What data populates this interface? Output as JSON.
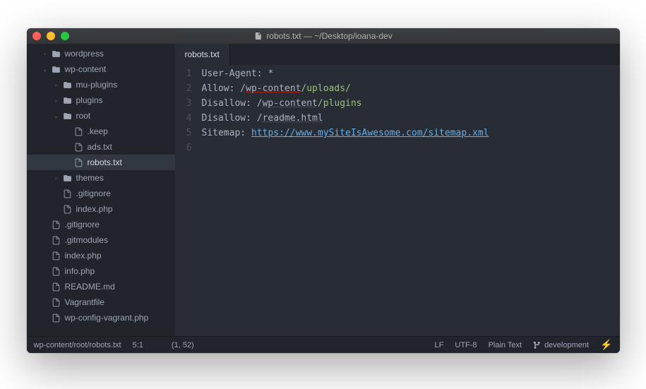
{
  "window": {
    "title": "robots.txt — ~/Desktop/ioana-dev"
  },
  "sidebar": {
    "rows": [
      {
        "indent": 1,
        "arrow": "›",
        "icon": "folder-open",
        "label": "wordpress"
      },
      {
        "indent": 1,
        "arrow": "⌄",
        "icon": "folder-open",
        "label": "wp-content"
      },
      {
        "indent": 2,
        "arrow": "›",
        "icon": "folder",
        "label": "mu-plugins"
      },
      {
        "indent": 2,
        "arrow": "›",
        "icon": "folder",
        "label": "plugins"
      },
      {
        "indent": 2,
        "arrow": "⌄",
        "icon": "folder",
        "label": "root"
      },
      {
        "indent": 3,
        "arrow": "",
        "icon": "file",
        "label": ".keep"
      },
      {
        "indent": 3,
        "arrow": "",
        "icon": "file",
        "label": "ads.txt"
      },
      {
        "indent": 3,
        "arrow": "",
        "icon": "file",
        "label": "robots.txt",
        "selected": true
      },
      {
        "indent": 2,
        "arrow": "›",
        "icon": "folder",
        "label": "themes"
      },
      {
        "indent": 2,
        "arrow": "",
        "icon": "file",
        "label": ".gitignore"
      },
      {
        "indent": 2,
        "arrow": "",
        "icon": "file",
        "label": "index.php"
      },
      {
        "indent": 1,
        "arrow": "",
        "icon": "file",
        "label": ".gitignore"
      },
      {
        "indent": 1,
        "arrow": "",
        "icon": "file",
        "label": ".gitmodules"
      },
      {
        "indent": 1,
        "arrow": "",
        "icon": "file",
        "label": "index.php"
      },
      {
        "indent": 1,
        "arrow": "",
        "icon": "file",
        "label": "info.php"
      },
      {
        "indent": 1,
        "arrow": "",
        "icon": "file",
        "label": "README.md"
      },
      {
        "indent": 1,
        "arrow": "",
        "icon": "file",
        "label": "Vagrantfile"
      },
      {
        "indent": 1,
        "arrow": "",
        "icon": "file",
        "label": "wp-config-vagrant.php"
      }
    ]
  },
  "tabs": [
    {
      "label": "robots.txt",
      "active": true
    }
  ],
  "editor": {
    "lines": [
      {
        "num": "1",
        "parts": [
          {
            "t": "User-Agent",
            "cls": "tok-key"
          },
          {
            "t": ": ",
            "cls": "tok-sep"
          },
          {
            "t": "*",
            "cls": "tok-key"
          }
        ]
      },
      {
        "num": "2",
        "parts": [
          {
            "t": "Allow",
            "cls": "tok-key"
          },
          {
            "t": ": /",
            "cls": "tok-sep"
          },
          {
            "t": "wp-content",
            "cls": "tok-underline"
          },
          {
            "t": "/uploads/",
            "cls": "tok-path"
          }
        ]
      },
      {
        "num": "3",
        "parts": [
          {
            "t": "Disallow",
            "cls": "tok-key"
          },
          {
            "t": ": /",
            "cls": "tok-sep"
          },
          {
            "t": "wp-content",
            "cls": "tok-underline"
          },
          {
            "t": "/plugins",
            "cls": "tok-path"
          }
        ]
      },
      {
        "num": "4",
        "parts": [
          {
            "t": "Disallow",
            "cls": "tok-key"
          },
          {
            "t": ": /",
            "cls": "tok-sep"
          },
          {
            "t": "readme.html",
            "cls": "tok-underline"
          }
        ]
      },
      {
        "num": "5",
        "parts": [
          {
            "t": "Sitemap",
            "cls": "tok-key"
          },
          {
            "t": ": ",
            "cls": "tok-sep"
          },
          {
            "t": "https://www.mySiteIsAwesome.com/sitemap.xml",
            "cls": "tok-url"
          }
        ]
      },
      {
        "num": "6",
        "parts": []
      }
    ]
  },
  "status": {
    "left_path": "wp-content/root/robots.txt",
    "left_pos": "5:1",
    "ruler": "(1, 52)",
    "eol": "LF",
    "encoding": "UTF-8",
    "grammar": "Plain Text",
    "branch": "development"
  }
}
